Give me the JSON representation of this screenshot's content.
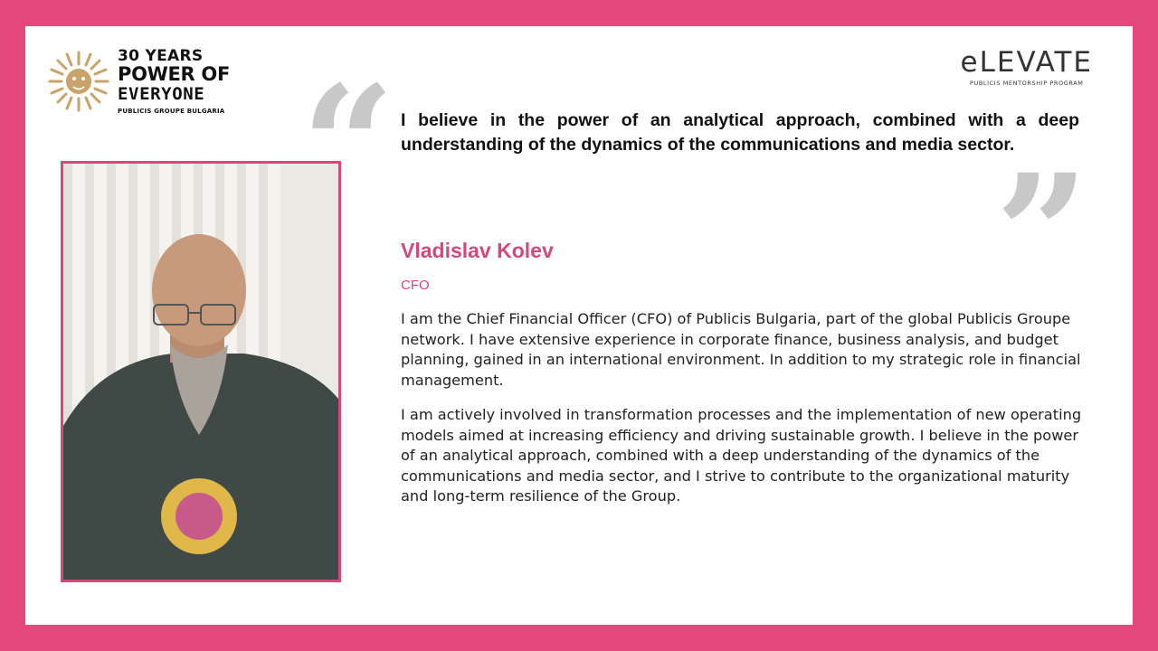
{
  "logo_left": {
    "line1": "30 YEARS",
    "line2": "POWER OF",
    "line3": "EVERYONE",
    "line4": "PUBLICIS GROUPE BULGARIA",
    "icon": "lion-sun-icon"
  },
  "logo_right": {
    "word": "eLEVATE",
    "sub": "PUBLICIS MENTORSHIP PROGRAM"
  },
  "quote": {
    "open_mark": "“",
    "close_mark": "”",
    "text": "I believe in the power of an analytical approach, combined with a deep understanding of the dynamics of the communications and media sector."
  },
  "person": {
    "name": "Vladislav Kolev",
    "role": "CFO",
    "bio_1": "I am the Chief Financial Officer (CFO) of Publicis Bulgaria, part of the global Publicis Groupe network. I have extensive experience in corporate finance, business analysis, and budget planning, gained in an international environment. In addition to my strategic role in financial management.",
    "bio_2": "I am actively involved in transformation processes and the implementation of new operating models aimed at increasing efficiency and driving sustainable growth. I believe in the power of an analytical approach, combined with a deep understanding of the dynamics of the communications and media sector, and I strive to contribute to the organizational maturity and long-term resilience of the Group."
  },
  "colors": {
    "frame": "#e5487c",
    "accent": "#d8477a",
    "quote_mark": "#c8c8c8"
  }
}
